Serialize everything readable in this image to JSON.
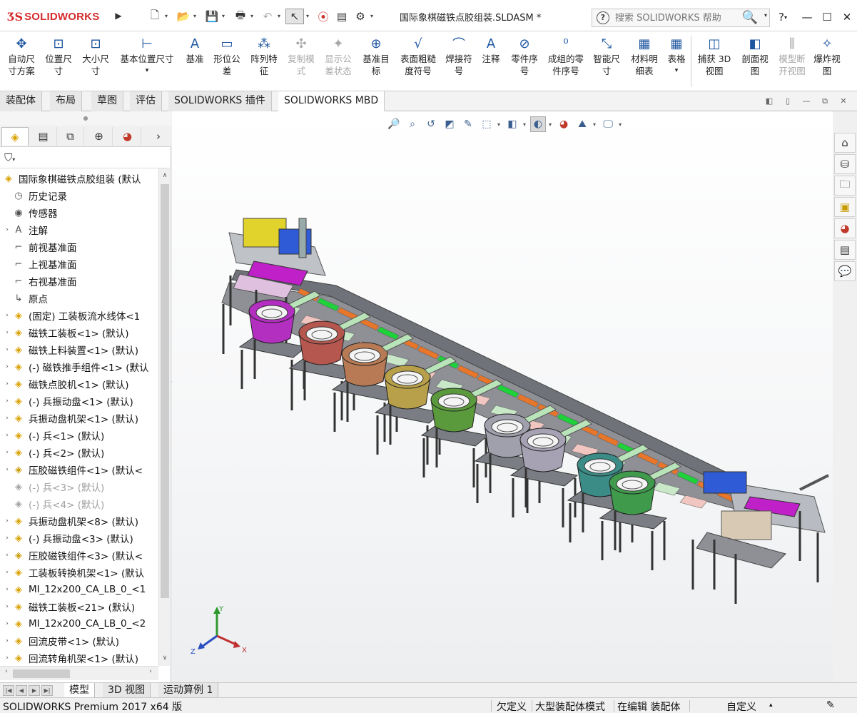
{
  "app": {
    "brand": "SOLIDWORKS",
    "doc_title": "国际象棋磁铁点胶组装.SLDASM *",
    "search_placeholder": "搜索 SOLIDWORKS 帮助",
    "help": "?",
    "win_min": "—",
    "win_max": "☐",
    "win_close": "✕"
  },
  "ribbon": {
    "items": [
      {
        "label": "自动尺\n寸方案",
        "icon": "✥"
      },
      {
        "label": "位置尺\n寸",
        "icon": "⊡"
      },
      {
        "label": "大小尺\n寸",
        "icon": "⊡"
      },
      {
        "label": "基本位置尺寸",
        "icon": "⊢",
        "sub": "▾"
      },
      {
        "label": "基准",
        "icon": "A"
      },
      {
        "label": "形位公\n差",
        "icon": "▭"
      },
      {
        "label": "阵列特\n征",
        "icon": "⁂"
      },
      {
        "label": "复制模\n式",
        "icon": "✣"
      },
      {
        "label": "显示公\n差状态",
        "icon": "✦"
      },
      {
        "label": "基准目\n标",
        "icon": "⊕"
      },
      {
        "label": "表面粗糙\n度符号",
        "icon": "√"
      },
      {
        "label": "焊接符\n号",
        "icon": "⌒"
      },
      {
        "label": "注释",
        "icon": "A"
      },
      {
        "label": "零件序\n号",
        "icon": "⊘"
      },
      {
        "label": "成组的零\n件序号",
        "icon": "⁰"
      },
      {
        "label": "智能尺\n寸",
        "icon": "⤡"
      },
      {
        "label": "材料明\n细表",
        "icon": "▦"
      },
      {
        "label": "表格",
        "icon": "▦",
        "sub": "▾"
      },
      {
        "label": "捕获 3D\n视图",
        "icon": "◫"
      },
      {
        "label": "剖面视\n图",
        "icon": "◧"
      },
      {
        "label": "模型断\n开视图",
        "icon": "⫼"
      },
      {
        "label": "爆炸视\n图",
        "icon": "✧"
      }
    ]
  },
  "tabs": [
    "装配体",
    "布局",
    "草图",
    "评估",
    "SOLIDWORKS 插件",
    "SOLIDWORKS MBD"
  ],
  "tree": {
    "root": "国际象棋磁铁点胶组装 (默认",
    "items": [
      {
        "label": "历史记录",
        "exp": "",
        "icon": "◷",
        "kind": "plane"
      },
      {
        "label": "传感器",
        "exp": "",
        "icon": "◉",
        "kind": "plane"
      },
      {
        "label": "注解",
        "exp": "›",
        "icon": "A",
        "kind": "plane"
      },
      {
        "label": "前视基准面",
        "exp": "",
        "icon": "⌐",
        "kind": "plane"
      },
      {
        "label": "上视基准面",
        "exp": "",
        "icon": "⌐",
        "kind": "plane"
      },
      {
        "label": "右视基准面",
        "exp": "",
        "icon": "⌐",
        "kind": "plane"
      },
      {
        "label": "原点",
        "exp": "",
        "icon": "↳",
        "kind": "plane"
      },
      {
        "label": "(固定) 工装板流水线体<1",
        "exp": "›",
        "icon": "◈",
        "kind": "asm"
      },
      {
        "label": "磁铁工装板<1> (默认)",
        "exp": "›",
        "icon": "◈",
        "kind": "asm"
      },
      {
        "label": "磁铁上料装置<1> (默认)",
        "exp": "›",
        "icon": "◈",
        "kind": "asm"
      },
      {
        "label": "(-) 磁铁推手组件<1> (默认",
        "exp": "›",
        "icon": "◈",
        "kind": "asm"
      },
      {
        "label": "磁铁点胶机<1> (默认)",
        "exp": "›",
        "icon": "◈",
        "kind": "asm"
      },
      {
        "label": "(-) 兵振动盘<1> (默认)",
        "exp": "›",
        "icon": "◈",
        "kind": "asm"
      },
      {
        "label": "兵振动盘机架<1> (默认)",
        "exp": "›",
        "icon": "◈",
        "kind": "asm"
      },
      {
        "label": "(-) 兵<1> (默认)",
        "exp": "›",
        "icon": "◈",
        "kind": "asm"
      },
      {
        "label": "(-) 兵<2> (默认)",
        "exp": "›",
        "icon": "◈",
        "kind": "asm"
      },
      {
        "label": "压胶磁铁组件<1> (默认<",
        "exp": "›",
        "icon": "◈",
        "kind": "part"
      },
      {
        "label": "(-) 兵<3> (默认)",
        "exp": "",
        "icon": "◈",
        "kind": "suppressed"
      },
      {
        "label": "(-) 兵<4> (默认)",
        "exp": "",
        "icon": "◈",
        "kind": "suppressed"
      },
      {
        "label": "兵振动盘机架<8> (默认)",
        "exp": "›",
        "icon": "◈",
        "kind": "asm"
      },
      {
        "label": "(-) 兵振动盘<3> (默认)",
        "exp": "›",
        "icon": "◈",
        "kind": "asm"
      },
      {
        "label": "压胶磁铁组件<3> (默认<",
        "exp": "›",
        "icon": "◈",
        "kind": "part"
      },
      {
        "label": "工装板转换机架<1> (默认",
        "exp": "›",
        "icon": "◈",
        "kind": "asm"
      },
      {
        "label": "MI_12x200_CA_LB_0_<1",
        "exp": "›",
        "icon": "◈",
        "kind": "asm"
      },
      {
        "label": "磁铁工装板<21> (默认)",
        "exp": "›",
        "icon": "◈",
        "kind": "asm"
      },
      {
        "label": "MI_12x200_CA_LB_0_<2",
        "exp": "›",
        "icon": "◈",
        "kind": "asm"
      },
      {
        "label": "回流皮带<1> (默认)",
        "exp": "›",
        "icon": "◈",
        "kind": "asm"
      },
      {
        "label": "回流转角机架<1> (默认)",
        "exp": "›",
        "icon": "◈",
        "kind": "asm"
      }
    ]
  },
  "triad": {
    "x": "X",
    "y": "Y",
    "z": "Z"
  },
  "bottom_tabs": [
    "模型",
    "3D 视图",
    "运动算例 1"
  ],
  "status": {
    "version": "SOLIDWORKS Premium 2017 x64 版",
    "defined": "欠定义",
    "mode": "大型装配体模式",
    "editing": "在编辑 装配体",
    "custom": "自定义"
  },
  "colors": {
    "accent": "#1e56a0",
    "brand_red": "#d52b2b",
    "bowl_colors": [
      "#b22fc0",
      "#b5574f",
      "#b77a54",
      "#b8a04a",
      "#5a9a3c",
      "#9fa0ac",
      "#a6a2b4",
      "#3b8b86",
      "#3f9a4c"
    ]
  }
}
